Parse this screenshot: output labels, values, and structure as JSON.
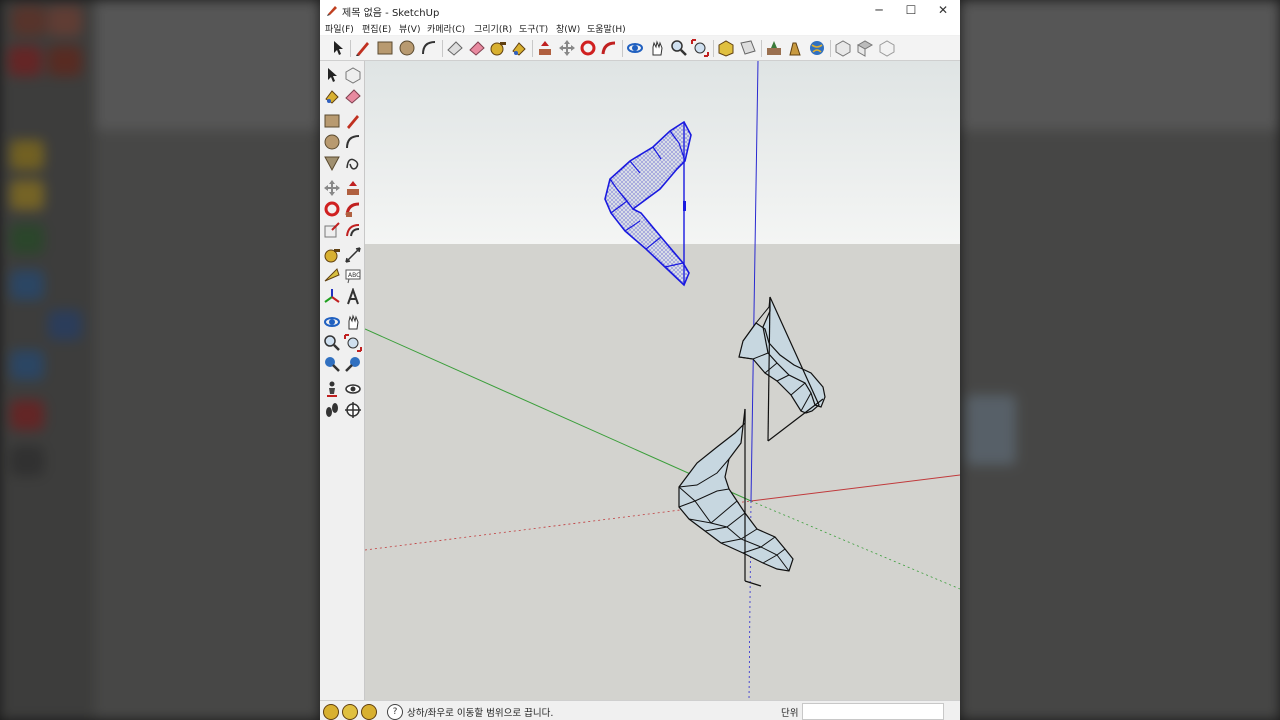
{
  "window": {
    "title": "제목 없음 - SketchUp",
    "minimize": "─",
    "maximize": "☐",
    "close": "✕"
  },
  "menu": {
    "items": [
      "파일(F)",
      "편집(E)",
      "뷰(V)",
      "카메라(C)",
      "그리기(R)",
      "도구(T)",
      "창(W)",
      "도움말(H)"
    ]
  },
  "toolbar": {
    "icons": [
      "select-icon",
      "pencil-icon",
      "rectangle-icon",
      "circle-icon",
      "arc-icon",
      "eraser-icon",
      "paint-bucket-icon",
      "tape-measure-icon",
      "paint-icon",
      "push-pull-icon",
      "move-icon",
      "rotate-icon",
      "follow-me-icon",
      "orbit-icon",
      "pan-icon",
      "zoom-icon",
      "zoom-extents-icon",
      "3d-warehouse-icon",
      "section-plane-icon",
      "add-location-icon",
      "components-icon",
      "globe-icon",
      "view-iso-icon",
      "view-top-icon",
      "view-front-icon"
    ]
  },
  "status": {
    "message": "상하/좌우로 이동할 범위으로 끕니다.",
    "unit_label": "단위",
    "measurement_value": ""
  },
  "colors": {
    "sky": "#eef1f1",
    "ground": "#d3d3cf",
    "red_axis": "#c0393b",
    "green_axis": "#3a9e3a",
    "blue_axis": "#2a2ad0",
    "selection": "#1a1ae0",
    "face": "#c7d7e0"
  }
}
